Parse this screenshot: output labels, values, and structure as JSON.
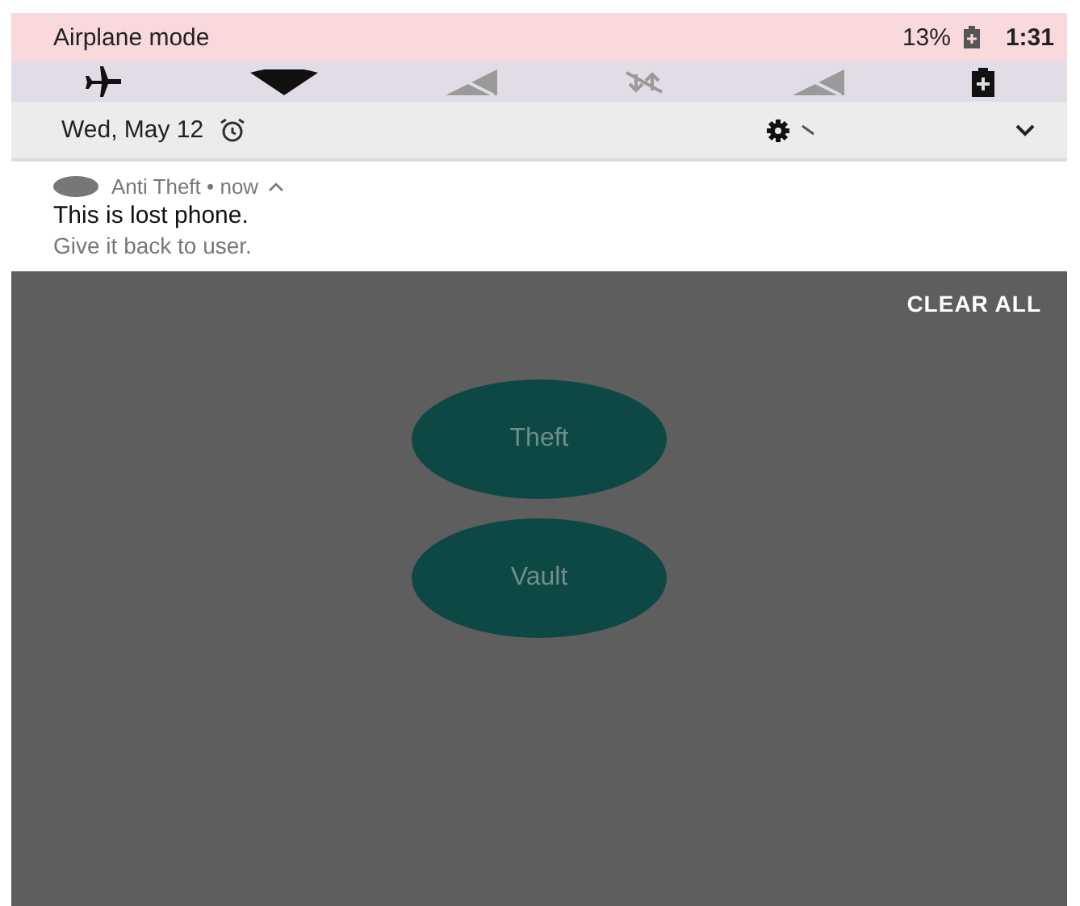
{
  "status_bar": {
    "mode": "Airplane mode",
    "battery": "13%",
    "time": "1:31"
  },
  "quick_tiles": [
    {
      "kind": "airplane",
      "on": true
    },
    {
      "kind": "wifi",
      "on": true
    },
    {
      "kind": "signal",
      "on": false
    },
    {
      "kind": "data",
      "on": false
    },
    {
      "kind": "signal",
      "on": false
    },
    {
      "kind": "battery",
      "on": true
    }
  ],
  "header": {
    "date": "Wed, May 12"
  },
  "notification": {
    "app": "Anti Theft",
    "separator": "•",
    "time": "now",
    "title": "This is lost phone.",
    "text": "Give it back to user.",
    "expanded": true
  },
  "clear_all": "CLEAR ALL",
  "buttons": [
    {
      "label": "Theft"
    },
    {
      "label": "Vault"
    }
  ]
}
